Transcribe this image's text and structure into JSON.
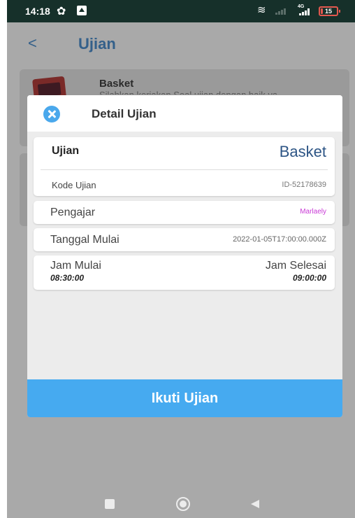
{
  "status_bar": {
    "time": "14:18",
    "network": "4G",
    "battery": "15",
    "battery_level": 0.15,
    "icons": [
      "gear-icon",
      "upload-icon",
      "wifi-icon",
      "signal-icon",
      "battery-icon"
    ]
  },
  "app_bar": {
    "back_icon": "<",
    "title": "Ujian"
  },
  "background_list": {
    "items": [
      {
        "title": "Basket",
        "subtitle": "Silahkan kerjakan Soal ujian dengan baik ya"
      }
    ]
  },
  "modal": {
    "title": "Detail Ujian",
    "subject_label": "Ujian",
    "subject_value": "Basket",
    "code_label": "Kode Ujian",
    "code_value": "ID-52178639",
    "teacher_label": "Pengajar",
    "teacher_value": "Marlaely",
    "date_label": "Tanggal Mulai",
    "date_value": "2022-01-05T17:00:00.000Z",
    "start_label": "Jam Mulai",
    "start_value": "08:30:00",
    "end_label": "Jam Selesai",
    "end_value": "09:00:00",
    "join_button": "Ikuti Ujian"
  },
  "colors": {
    "status_bar": "#16302a",
    "accent": "#46aaf0",
    "title": "#34608a",
    "teacher": "#c93ad6",
    "battery": "#e3584f"
  }
}
